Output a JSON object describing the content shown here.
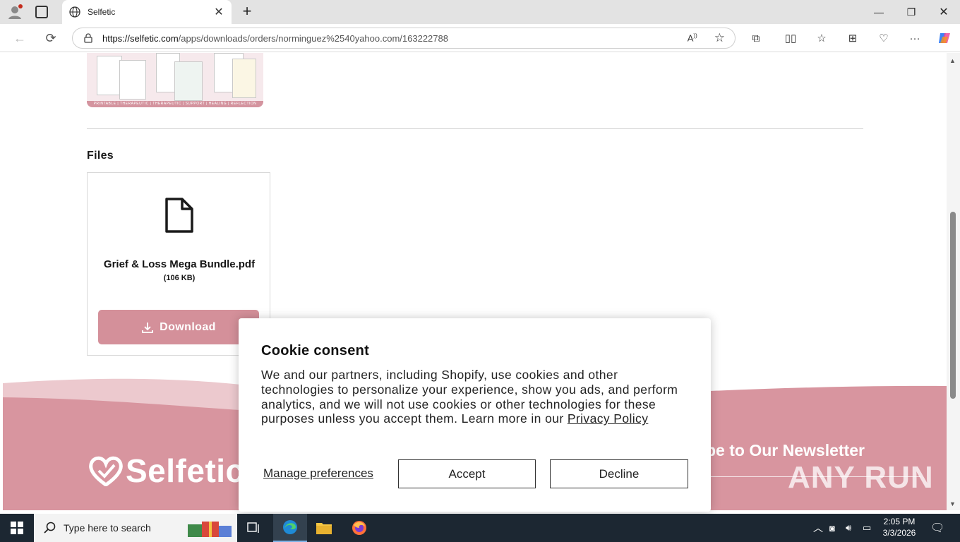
{
  "browser": {
    "tab_title": "Selfetic",
    "url_domain": "https://selfetic.com",
    "url_path": "/apps/downloads/orders/norminguez%2540yahoo.com/163222788"
  },
  "page": {
    "product_image_strip": "PRINTABLE | THERAPEUTIC | THERAPEUTIC | SUPPORT | HEALING | REFLECTION",
    "files_heading": "Files",
    "file": {
      "name": "Grief & Loss Mega Bundle.pdf",
      "size": "(106 KB)",
      "download_label": "Download"
    },
    "footer": {
      "logo_text": "Selfetic",
      "newsletter_title": "be to Our Newsletter",
      "watermark": "ANY RUN"
    }
  },
  "cookie": {
    "title": "Cookie consent",
    "body": "We and our partners, including Shopify, use cookies and other technologies to personalize your experience, show you ads, and perform analytics, and we will not use cookies or other technologies for these purposes unless you accept them. Learn more in our ",
    "privacy_link": "Privacy Policy",
    "manage_label": "Manage preferences",
    "accept_label": "Accept",
    "decline_label": "Decline"
  },
  "taskbar": {
    "search_placeholder": "Type here to search",
    "time": "2:05 PM",
    "date": "3/3/2026"
  },
  "colors": {
    "accent_pink": "#d4909a",
    "footer_pink": "#d8959f",
    "taskbar": "#1c2732"
  }
}
